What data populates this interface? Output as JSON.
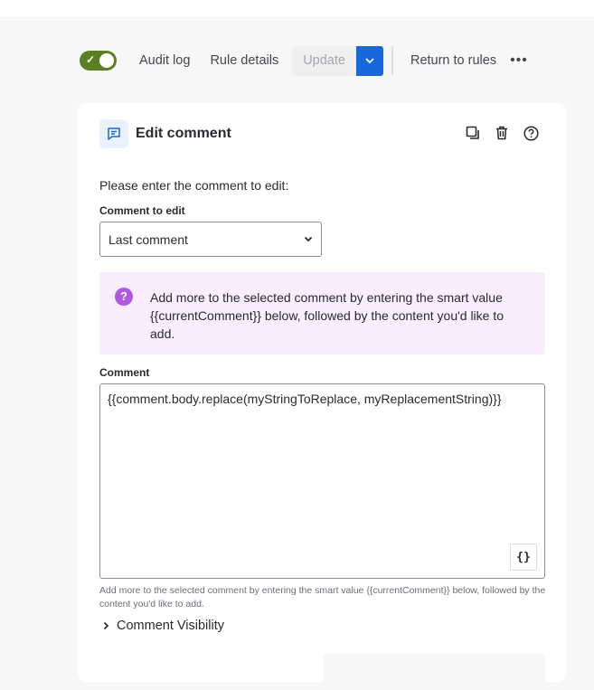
{
  "toolbar": {
    "audit_log": "Audit log",
    "rule_details": "Rule details",
    "update": "Update",
    "return": "Return to rules",
    "more": "•••",
    "enabled": true
  },
  "card": {
    "title": "Edit comment",
    "prompt": "Please enter the comment to edit:",
    "select_label": "Comment to edit",
    "select_value": "Last comment",
    "info": "Add more to the selected comment by entering the smart value {{currentComment}} below, followed by the content you'd like to add.",
    "comment_label": "Comment",
    "comment_value": "{{comment.body.replace(myStringToReplace, myReplacementString)}}",
    "smart_value_button": "{}",
    "help": "Add more to the selected comment by entering the smart value {{currentComment}} below, followed by the content you'd like to add.",
    "visibility": "Comment Visibility"
  }
}
